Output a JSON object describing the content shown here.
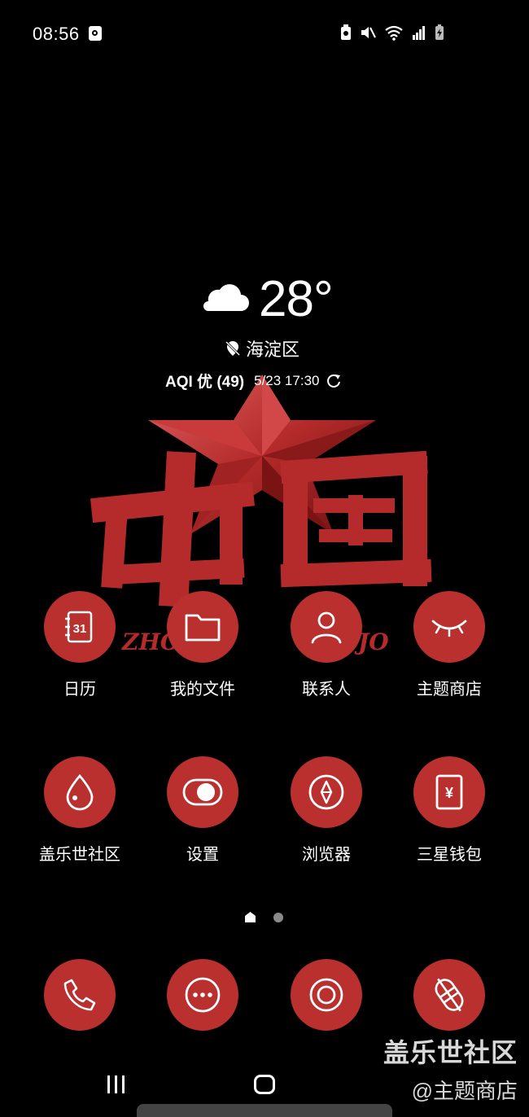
{
  "status_bar": {
    "time": "08:56"
  },
  "weather": {
    "temperature": "28°",
    "location": "海淀区",
    "aqi_label": "AQI 优 (49)",
    "updated": "5/23 17:30"
  },
  "wallpaper": {
    "text_main": "中国",
    "text_sub_left": "ZHO",
    "text_sub_right": "JO"
  },
  "apps_row1": [
    {
      "label": "日历",
      "icon": "calendar-icon",
      "badge": "31"
    },
    {
      "label": "我的文件",
      "icon": "folder-icon"
    },
    {
      "label": "联系人",
      "icon": "contacts-icon"
    },
    {
      "label": "主题商店",
      "icon": "eye-closed-icon"
    }
  ],
  "apps_row2": [
    {
      "label": "盖乐世社区",
      "icon": "drop-icon"
    },
    {
      "label": "设置",
      "icon": "toggle-icon"
    },
    {
      "label": "浏览器",
      "icon": "compass-icon"
    },
    {
      "label": "三星钱包",
      "icon": "wallet-icon",
      "badge": "¥"
    }
  ],
  "dock": [
    {
      "icon": "phone-icon"
    },
    {
      "icon": "messages-icon"
    },
    {
      "icon": "camera-icon"
    },
    {
      "icon": "bixby-icon"
    }
  ],
  "watermark": {
    "line1": "盖乐世社区",
    "line2": "@主题商店"
  },
  "colors": {
    "accent": "#b9302f",
    "background": "#000000"
  }
}
